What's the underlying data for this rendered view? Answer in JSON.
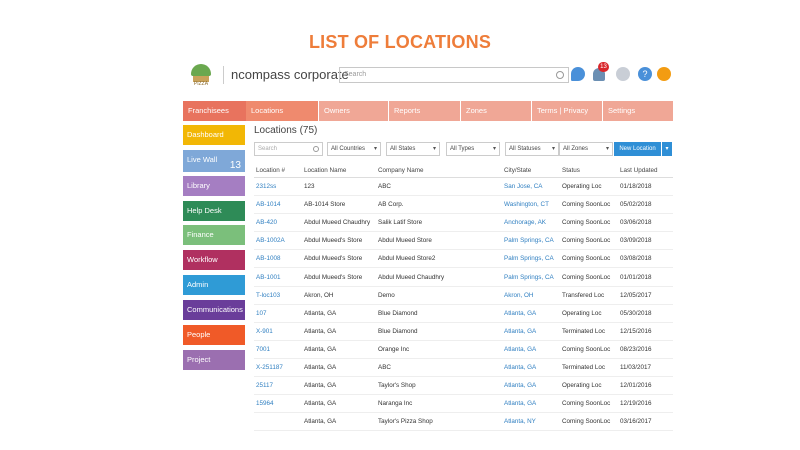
{
  "slide_title": "LIST OF LOCATIONS",
  "header": {
    "logo_text": "PIZZA",
    "company": "ncompass corporate",
    "search_placeholder": "Search",
    "notification_count": "13"
  },
  "topnav": [
    {
      "label": "Franchisees",
      "color": "#e8735e"
    },
    {
      "label": "Locations",
      "color": "#ef8a6e"
    },
    {
      "label": "Owners",
      "color": "#f0a796"
    },
    {
      "label": "Reports",
      "color": "#f0a796"
    },
    {
      "label": "Zones",
      "color": "#f0a796"
    },
    {
      "label": "Terms | Privacy",
      "color": "#f0a796"
    },
    {
      "label": "Settings",
      "color": "#f0a796"
    }
  ],
  "sidebar": [
    {
      "label": "Dashboard",
      "color": "#f2b705"
    },
    {
      "label": "Live Wall",
      "color": "#7fa8d8",
      "count": "13"
    },
    {
      "label": "Library",
      "color": "#a57ec2"
    },
    {
      "label": "Help Desk",
      "color": "#2e8b57"
    },
    {
      "label": "Finance",
      "color": "#7bbf7b"
    },
    {
      "label": "Workflow",
      "color": "#b03060"
    },
    {
      "label": "Admin",
      "color": "#2f9bd6"
    },
    {
      "label": "Communications",
      "color": "#6a3d9a"
    },
    {
      "label": "People",
      "color": "#f05a28"
    },
    {
      "label": "Project",
      "color": "#9b6fb0"
    }
  ],
  "main": {
    "title": "Locations (75)",
    "search_placeholder": "Search",
    "filters": [
      "All Countries",
      "All States",
      "All Types",
      "All Statuses",
      "All Zones"
    ],
    "new_button": "New Location"
  },
  "table": {
    "columns": [
      "Location #",
      "Location Name",
      "Company Name",
      "City/State",
      "Status",
      "Last Updated"
    ],
    "rows": [
      [
        "2312ss",
        "123",
        "ABC",
        "San Jose, CA",
        "Operating Loc",
        "01/18/2018"
      ],
      [
        "AB-1014",
        "AB-1014 Store",
        "AB Corp.",
        "Washington, CT",
        "Coming SoonLoc",
        "05/02/2018"
      ],
      [
        "AB-420",
        "Abdul Mueed Chaudhry",
        "Salik Latif Store",
        "Anchorage, AK",
        "Coming SoonLoc",
        "03/06/2018"
      ],
      [
        "AB-1002A",
        "Abdul Mueed's Store",
        "Abdul Mueed Store",
        "Palm Springs, CA",
        "Coming SoonLoc",
        "03/09/2018"
      ],
      [
        "AB-1008",
        "Abdul Mueed's Store",
        "Abdul Mueed Store2",
        "Palm Springs, CA",
        "Coming SoonLoc",
        "03/08/2018"
      ],
      [
        "AB-1001",
        "Abdul Mueed's Store",
        "Abdul Mueed Chaudhry",
        "Palm Springs, CA",
        "Coming SoonLoc",
        "01/01/2018"
      ],
      [
        "T-loc103",
        "Akron, OH",
        "Demo",
        "Akron, OH",
        "Transfered Loc",
        "12/05/2017"
      ],
      [
        "107",
        "Atlanta, GA",
        "Blue Diamond",
        "Atlanta, GA",
        "Operating Loc",
        "05/30/2018"
      ],
      [
        "X-901",
        "Atlanta, GA",
        "Blue Diamond",
        "Atlanta, GA",
        "Terminated Loc",
        "12/15/2016"
      ],
      [
        "7001",
        "Atlanta, GA",
        "Orange Inc",
        "Atlanta, GA",
        "Coming SoonLoc",
        "08/23/2016"
      ],
      [
        "X-251187",
        "Atlanta, GA",
        "ABC",
        "Atlanta, GA",
        "Terminated Loc",
        "11/03/2017"
      ],
      [
        "25117",
        "Atlanta, GA",
        "Taylor's Shop",
        "Atlanta, GA",
        "Operating Loc",
        "12/01/2016"
      ],
      [
        "15964",
        "Atlanta, GA",
        "Naranga Inc",
        "Atlanta, GA",
        "Coming SoonLoc",
        "12/19/2016"
      ],
      [
        "",
        "Atlanta, GA",
        "Taylor's Pizza Shop",
        "Atlanta, NY",
        "Coming SoonLoc",
        "03/16/2017"
      ]
    ]
  }
}
